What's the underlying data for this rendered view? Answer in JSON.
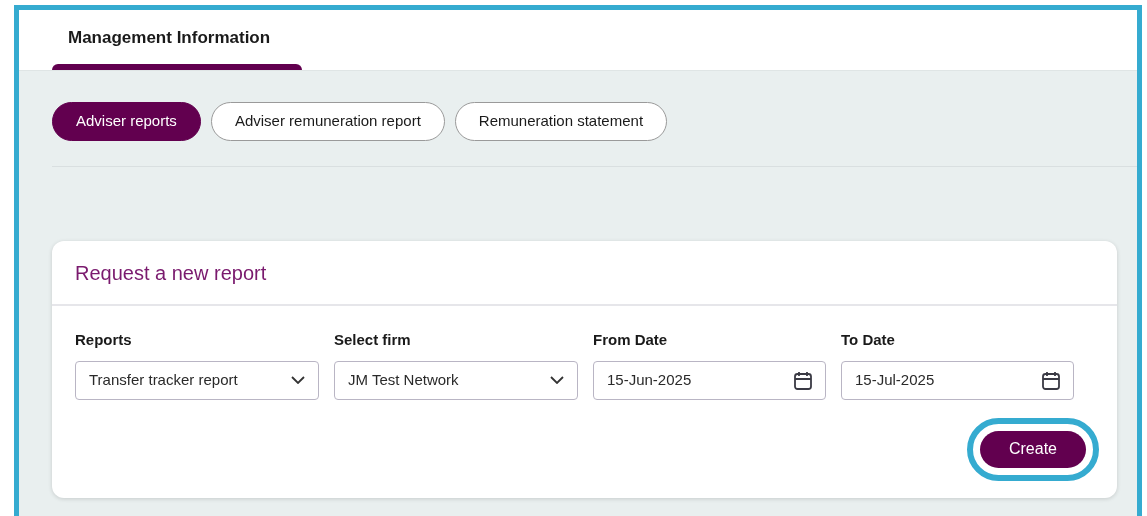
{
  "header_tabs": [
    {
      "label": "Management Information",
      "selected": true
    }
  ],
  "report_tabs": [
    {
      "label": "Adviser reports",
      "selected": true
    },
    {
      "label": "Adviser remuneration report",
      "selected": false
    },
    {
      "label": "Remuneration statement",
      "selected": false
    }
  ],
  "card": {
    "title": "Request a new report",
    "fields": [
      {
        "kind": "select",
        "label": "Reports",
        "value": "Transfer tracker report"
      },
      {
        "kind": "select",
        "label": "Select firm",
        "value": "JM Test Network"
      },
      {
        "kind": "date",
        "label": "From Date",
        "value": "15-Jun-2025"
      },
      {
        "kind": "date",
        "label": "To Date",
        "value": "15-Jul-2025"
      }
    ],
    "button": {
      "label": "Create",
      "highlighted": true
    }
  }
}
